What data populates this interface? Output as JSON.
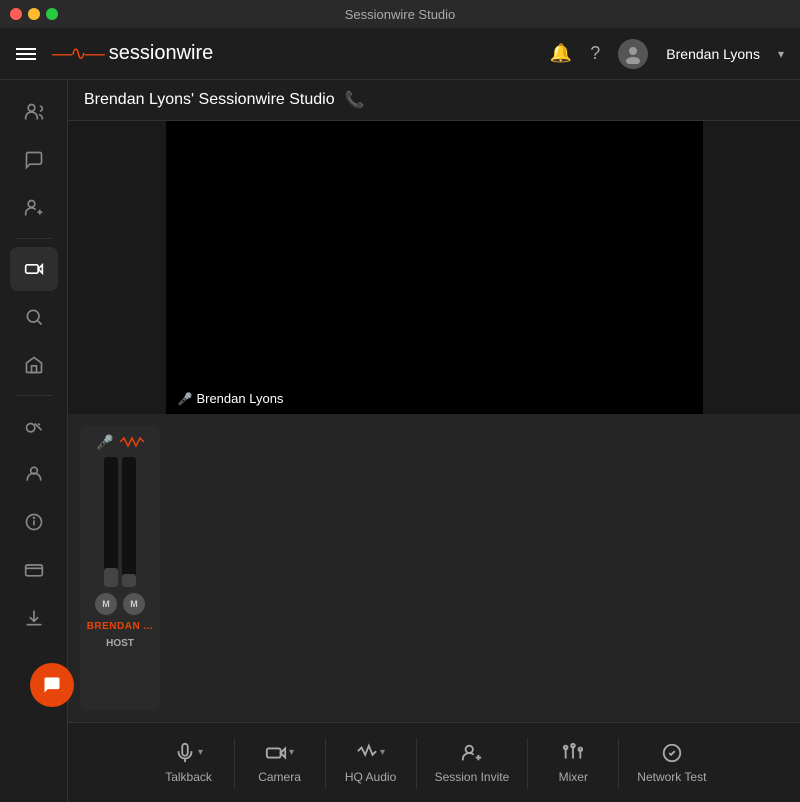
{
  "window": {
    "title": "Sessionwire Studio"
  },
  "titlebar": {
    "title": "Sessionwire Studio"
  },
  "topnav": {
    "logo_wave": "~∿~",
    "logo_text": "sessionwire",
    "username": "Brendan Lyons",
    "chevron": "▾"
  },
  "studio": {
    "title": "Brendan Lyons' Sessionwire Studio"
  },
  "video": {
    "user_label": "Brendan Lyons"
  },
  "channel": {
    "name": "BRENDAN ...",
    "role": "HOST",
    "mute_left": "M",
    "mute_right": "M"
  },
  "sidebar": {
    "items": [
      {
        "id": "users",
        "icon": "👤"
      },
      {
        "id": "chat",
        "icon": "💬"
      },
      {
        "id": "add-user",
        "icon": "👤+"
      },
      {
        "id": "video",
        "icon": "📹"
      },
      {
        "id": "search",
        "icon": "🔍"
      },
      {
        "id": "home",
        "icon": "🏠"
      },
      {
        "id": "key",
        "icon": "🔑"
      },
      {
        "id": "person",
        "icon": "👤"
      },
      {
        "id": "info",
        "icon": "ℹ"
      },
      {
        "id": "card",
        "icon": "💳"
      },
      {
        "id": "download",
        "icon": "⬇"
      }
    ]
  },
  "toolbar": {
    "items": [
      {
        "id": "talkback",
        "label": "Talkback"
      },
      {
        "id": "camera",
        "label": "Camera"
      },
      {
        "id": "hq-audio",
        "label": "HQ Audio"
      },
      {
        "id": "session-invite",
        "label": "Session Invite"
      },
      {
        "id": "mixer",
        "label": "Mixer"
      },
      {
        "id": "network-test",
        "label": "Network Test"
      }
    ]
  },
  "chat_bubble": {
    "icon": "💬"
  }
}
